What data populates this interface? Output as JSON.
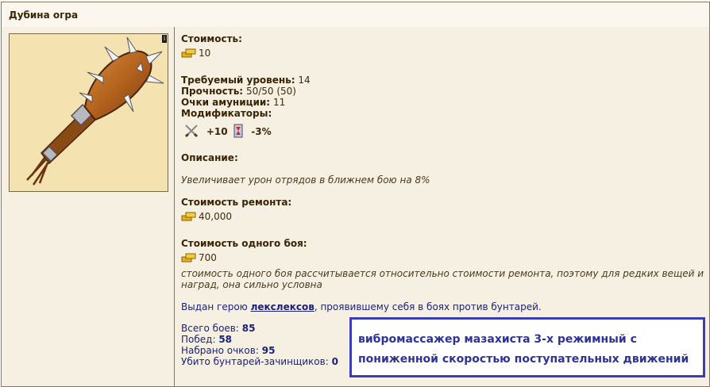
{
  "window": {
    "title": "Дубина огра"
  },
  "item": {
    "cost_label": "Стоимость:",
    "cost_value": "10",
    "level_label": "Требуемый уровень:",
    "level_value": "14",
    "durability_label": "Прочность:",
    "durability_value": "50/50  (50)",
    "ammo_label": "Очки амуниции:",
    "ammo_value": "11",
    "modifiers_label": "Модификаторы:",
    "mod_attack": "+10",
    "mod_speed": "-3%",
    "description_label": "Описание:",
    "description_text": "Увеличивает урон отрядов в ближнем бою на 8%",
    "repair_label": "Стоимость ремонта:",
    "repair_value": "40,000",
    "battle_cost_label": "Стоимость одного боя:",
    "battle_cost_value": "700",
    "battle_note_1": "стоимость одного боя рассчитывается относительно стоимости ремонта, поэтому для редких вещей и",
    "battle_note_2": "наград, она сильно условна",
    "issued_prefix": "Выдан герою ",
    "issued_hero": "лекслексов",
    "issued_suffix": ", проявившему себя в боях против бунтарей."
  },
  "stats": {
    "battles_label": "Всего боев:",
    "battles_value": "85",
    "wins_label": "Побед:",
    "wins_value": "58",
    "points_label": "Набрано очков:",
    "points_value": "95",
    "killed_label": "Убито бунтарей-зачинщиков:",
    "killed_value": "0"
  },
  "annotation": {
    "line1": "вибромассажер мазахиста 3-х режимный с",
    "line2": "пониженной скоростью поступательных движений"
  },
  "colors": {
    "frame_border": "#8a7556",
    "panel_bg": "#f5f0e1",
    "link": "#1a1f7a",
    "note_border": "#3a3db3"
  }
}
